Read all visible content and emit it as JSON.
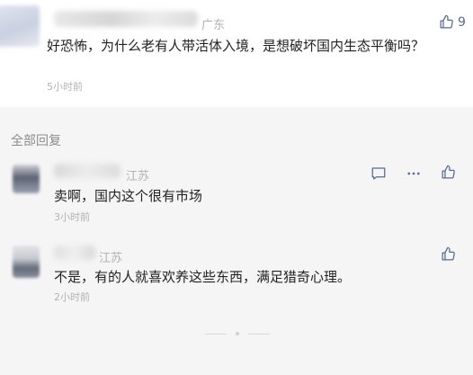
{
  "top_comment": {
    "location": "广东",
    "text": "好恐怖，为什么老有人带活体入境，是想破坏国内生态平衡吗？",
    "time": "5小时前",
    "likes": "9"
  },
  "replies_section": {
    "title": "全部回复",
    "items": [
      {
        "location": "江苏",
        "text": "卖啊，国内这个很有市场",
        "time": "3小时前"
      },
      {
        "location": "江苏",
        "text": "不是，有的人就喜欢养这些东西，满足猎奇心理。",
        "time": "2小时前"
      }
    ]
  },
  "colors": {
    "link": "#576b95",
    "meta": "#b2b2b2",
    "text": "#222222"
  }
}
